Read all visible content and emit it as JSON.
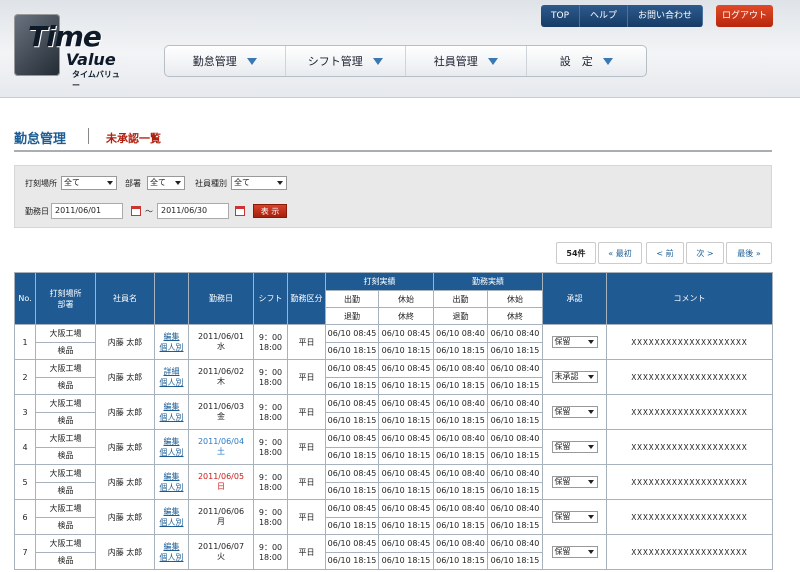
{
  "header": {
    "logo": {
      "line1": "Time",
      "line2": "Value",
      "line3": "タイムバリュー"
    },
    "topnav": [
      "TOP",
      "ヘルプ",
      "お問い合わせ"
    ],
    "logout": "ログアウト",
    "mainnav": [
      "勤怠管理",
      "シフト管理",
      "社員管理",
      "設　定"
    ]
  },
  "page": {
    "title": "勤怠管理",
    "subtitle": "未承認一覧"
  },
  "filter": {
    "location_label": "打刻場所",
    "location_value": "全て",
    "dept_label": "部署",
    "dept_value": "全て",
    "emptype_label": "社員種別",
    "emptype_value": "全て",
    "date_label": "勤務日",
    "date_from": "2011/06/01",
    "tilde": "～",
    "date_to": "2011/06/30",
    "show_button": "表 示"
  },
  "pager": {
    "count": "54件",
    "first": "« 最初",
    "prev": "< 前",
    "next": "次 >",
    "last": "最後 »"
  },
  "table": {
    "headers": {
      "no": "No.",
      "location": "打刻場所",
      "dept": "部署",
      "name": "社員名",
      "date": "勤務日",
      "shift": "シフト",
      "kind": "勤務区分",
      "actual": "打刻実績",
      "work": "勤務実績",
      "in": "出勤",
      "break_start": "休始",
      "out": "退勤",
      "break_end": "休終",
      "approval": "承認",
      "comment": "コメント"
    },
    "rows": [
      {
        "no": "1",
        "location": "大阪工場",
        "dept": "検品",
        "name": "内藤 太郎",
        "link1": "編集",
        "link2": "個人別",
        "date": "2011/06/01",
        "dow": "水",
        "color": "",
        "shift_start": "9：00",
        "shift_end": "18:00",
        "kind": "平日",
        "a_in": "06/10 08:45",
        "a_bs": "06/10 08:45",
        "a_out": "06/10 18:15",
        "a_be": "06/10 18:15",
        "w_in": "06/10 08:40",
        "w_bs": "06/10 08:40",
        "w_out": "06/10 18:15",
        "w_be": "06/10 18:15",
        "approval": "保留",
        "comment": "XXXXXXXXXXXXXXXXXXXX"
      },
      {
        "no": "2",
        "location": "大阪工場",
        "dept": "検品",
        "name": "内藤 太郎",
        "link1": "詳細",
        "link2": "個人別",
        "date": "2011/06/02",
        "dow": "木",
        "color": "",
        "shift_start": "9：00",
        "shift_end": "18:00",
        "kind": "平日",
        "a_in": "06/10 08:45",
        "a_bs": "06/10 08:45",
        "a_out": "06/10 18:15",
        "a_be": "06/10 18:15",
        "w_in": "06/10 08:40",
        "w_bs": "06/10 08:40",
        "w_out": "06/10 18:15",
        "w_be": "06/10 18:15",
        "approval": "未承認",
        "comment": "XXXXXXXXXXXXXXXXXXXX"
      },
      {
        "no": "3",
        "location": "大阪工場",
        "dept": "検品",
        "name": "内藤 太郎",
        "link1": "編集",
        "link2": "個人別",
        "date": "2011/06/03",
        "dow": "金",
        "color": "",
        "shift_start": "9：00",
        "shift_end": "18:00",
        "kind": "平日",
        "a_in": "06/10 08:45",
        "a_bs": "06/10 08:45",
        "a_out": "06/10 18:15",
        "a_be": "06/10 18:15",
        "w_in": "06/10 08:40",
        "w_bs": "06/10 08:40",
        "w_out": "06/10 18:15",
        "w_be": "06/10 18:15",
        "approval": "保留",
        "comment": "XXXXXXXXXXXXXXXXXXXX"
      },
      {
        "no": "4",
        "location": "大阪工場",
        "dept": "検品",
        "name": "内藤 太郎",
        "link1": "編集",
        "link2": "個人別",
        "date": "2011/06/04",
        "dow": "土",
        "color": "blue",
        "shift_start": "9：00",
        "shift_end": "18:00",
        "kind": "平日",
        "a_in": "06/10 08:45",
        "a_bs": "06/10 08:45",
        "a_out": "06/10 18:15",
        "a_be": "06/10 18:15",
        "w_in": "06/10 08:40",
        "w_bs": "06/10 08:40",
        "w_out": "06/10 18:15",
        "w_be": "06/10 18:15",
        "approval": "保留",
        "comment": "XXXXXXXXXXXXXXXXXXXX"
      },
      {
        "no": "5",
        "location": "大阪工場",
        "dept": "検品",
        "name": "内藤 太郎",
        "link1": "編集",
        "link2": "個人別",
        "date": "2011/06/05",
        "dow": "日",
        "color": "red",
        "shift_start": "9：00",
        "shift_end": "18:00",
        "kind": "平日",
        "a_in": "06/10 08:45",
        "a_bs": "06/10 08:45",
        "a_out": "06/10 18:15",
        "a_be": "06/10 18:15",
        "w_in": "06/10 08:40",
        "w_bs": "06/10 08:40",
        "w_out": "06/10 18:15",
        "w_be": "06/10 18:15",
        "approval": "保留",
        "comment": "XXXXXXXXXXXXXXXXXXXX"
      },
      {
        "no": "6",
        "location": "大阪工場",
        "dept": "検品",
        "name": "内藤 太郎",
        "link1": "編集",
        "link2": "個人別",
        "date": "2011/06/06",
        "dow": "月",
        "color": "",
        "shift_start": "9：00",
        "shift_end": "18:00",
        "kind": "平日",
        "a_in": "06/10 08:45",
        "a_bs": "06/10 08:45",
        "a_out": "06/10 18:15",
        "a_be": "06/10 18:15",
        "w_in": "06/10 08:40",
        "w_bs": "06/10 08:40",
        "w_out": "06/10 18:15",
        "w_be": "06/10 18:15",
        "approval": "保留",
        "comment": "XXXXXXXXXXXXXXXXXXXX"
      },
      {
        "no": "7",
        "location": "大阪工場",
        "dept": "検品",
        "name": "内藤 太郎",
        "link1": "編集",
        "link2": "個人別",
        "date": "2011/06/07",
        "dow": "火",
        "color": "",
        "shift_start": "9：00",
        "shift_end": "18:00",
        "kind": "平日",
        "a_in": "06/10 08:45",
        "a_bs": "06/10 08:45",
        "a_out": "06/10 18:15",
        "a_be": "06/10 18:15",
        "w_in": "06/10 08:40",
        "w_bs": "06/10 08:40",
        "w_out": "06/10 18:15",
        "w_be": "06/10 18:15",
        "approval": "保留",
        "comment": "XXXXXXXXXXXXXXXXXXXX"
      }
    ]
  }
}
